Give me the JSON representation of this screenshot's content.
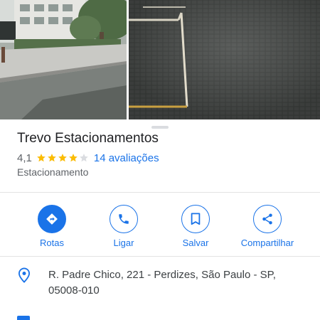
{
  "place": {
    "title": "Trevo Estacionamentos",
    "rating": "4,1",
    "stars": 4,
    "stars_max": 5,
    "reviews": "14 avaliações",
    "category": "Estacionamento"
  },
  "actions": [
    {
      "label": "Rotas",
      "icon": "directions-icon"
    },
    {
      "label": "Ligar",
      "icon": "phone-icon"
    },
    {
      "label": "Salvar",
      "icon": "bookmark-icon"
    },
    {
      "label": "Compartilhar",
      "icon": "share-icon"
    }
  ],
  "address": {
    "text": "R. Padre Chico, 221 - Perdizes, São Paulo - SP, 05008-010",
    "icon": "location-pin-icon"
  },
  "colors": {
    "accent": "#1a73e8",
    "star": "#fbbc04",
    "star_empty": "#dadce0",
    "title_text": "#202124",
    "secondary_text": "#5f6368"
  }
}
